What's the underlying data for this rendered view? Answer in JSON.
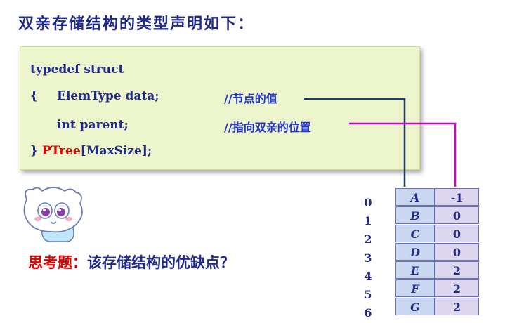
{
  "heading": "双亲存储结构的类型声明如下：",
  "code": {
    "line1": "typedef struct",
    "line2_brace": "{",
    "line2_field": "ElemType data;",
    "line2_comment": "//节点的值",
    "line3_field": "int parent;",
    "line3_comment": "//指向双亲的位置",
    "line4_prefix": "} ",
    "line4_type": "PTree",
    "line4_suffix": "[MaxSize];"
  },
  "question": {
    "label": "思考题：",
    "text": "该存储结构的优缺点？"
  },
  "table": {
    "indices": [
      "0",
      "1",
      "2",
      "3",
      "4",
      "5",
      "6"
    ],
    "rows": [
      {
        "data": "A",
        "parent": "-1"
      },
      {
        "data": "B",
        "parent": "0"
      },
      {
        "data": "C",
        "parent": "0"
      },
      {
        "data": "D",
        "parent": "0"
      },
      {
        "data": "E",
        "parent": "2"
      },
      {
        "data": "F",
        "parent": "2"
      },
      {
        "data": "G",
        "parent": "2"
      }
    ]
  },
  "colors": {
    "data_connector": "#1f3b66",
    "parent_connector": "#cc00cc",
    "accent_red": "#e60000",
    "text_blue": "#1f2a8a"
  }
}
